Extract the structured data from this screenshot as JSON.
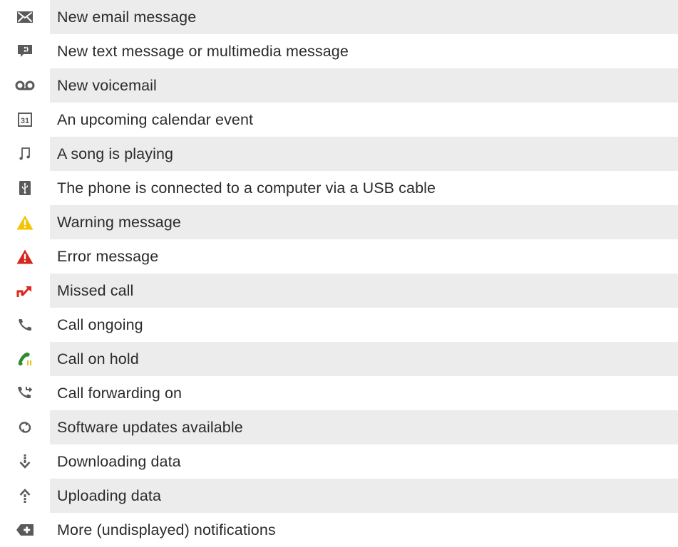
{
  "rows": [
    {
      "icon": "email-icon",
      "label": "New email message"
    },
    {
      "icon": "text-message-icon",
      "label": "New text message or multimedia message"
    },
    {
      "icon": "voicemail-icon",
      "label": "New voicemail"
    },
    {
      "icon": "calendar-icon",
      "label": "An upcoming calendar event",
      "icon_text": "31"
    },
    {
      "icon": "music-note-icon",
      "label": "A song is playing"
    },
    {
      "icon": "usb-icon",
      "label": "The phone is connected to a computer via a USB cable"
    },
    {
      "icon": "warning-icon",
      "label": "Warning message"
    },
    {
      "icon": "error-icon",
      "label": "Error message"
    },
    {
      "icon": "missed-call-icon",
      "label": "Missed call"
    },
    {
      "icon": "call-ongoing-icon",
      "label": "Call ongoing"
    },
    {
      "icon": "call-on-hold-icon",
      "label": "Call on hold"
    },
    {
      "icon": "call-forwarding-icon",
      "label": "Call forwarding on"
    },
    {
      "icon": "software-update-icon",
      "label": "Software updates available"
    },
    {
      "icon": "download-icon",
      "label": "Downloading data"
    },
    {
      "icon": "upload-icon",
      "label": "Uploading data"
    },
    {
      "icon": "more-notifications-icon",
      "label": "More (undisplayed) notifications"
    }
  ],
  "colors": {
    "row_shade": "#ececed",
    "icon_gray": "#5a5a5a",
    "warning_yellow": "#f5c400",
    "error_red": "#d4261c",
    "missed_call_red": "#e0251b",
    "hold_green": "#2e8b2e",
    "hold_yellow": "#e3c21a",
    "text": "#2b2b2b"
  }
}
